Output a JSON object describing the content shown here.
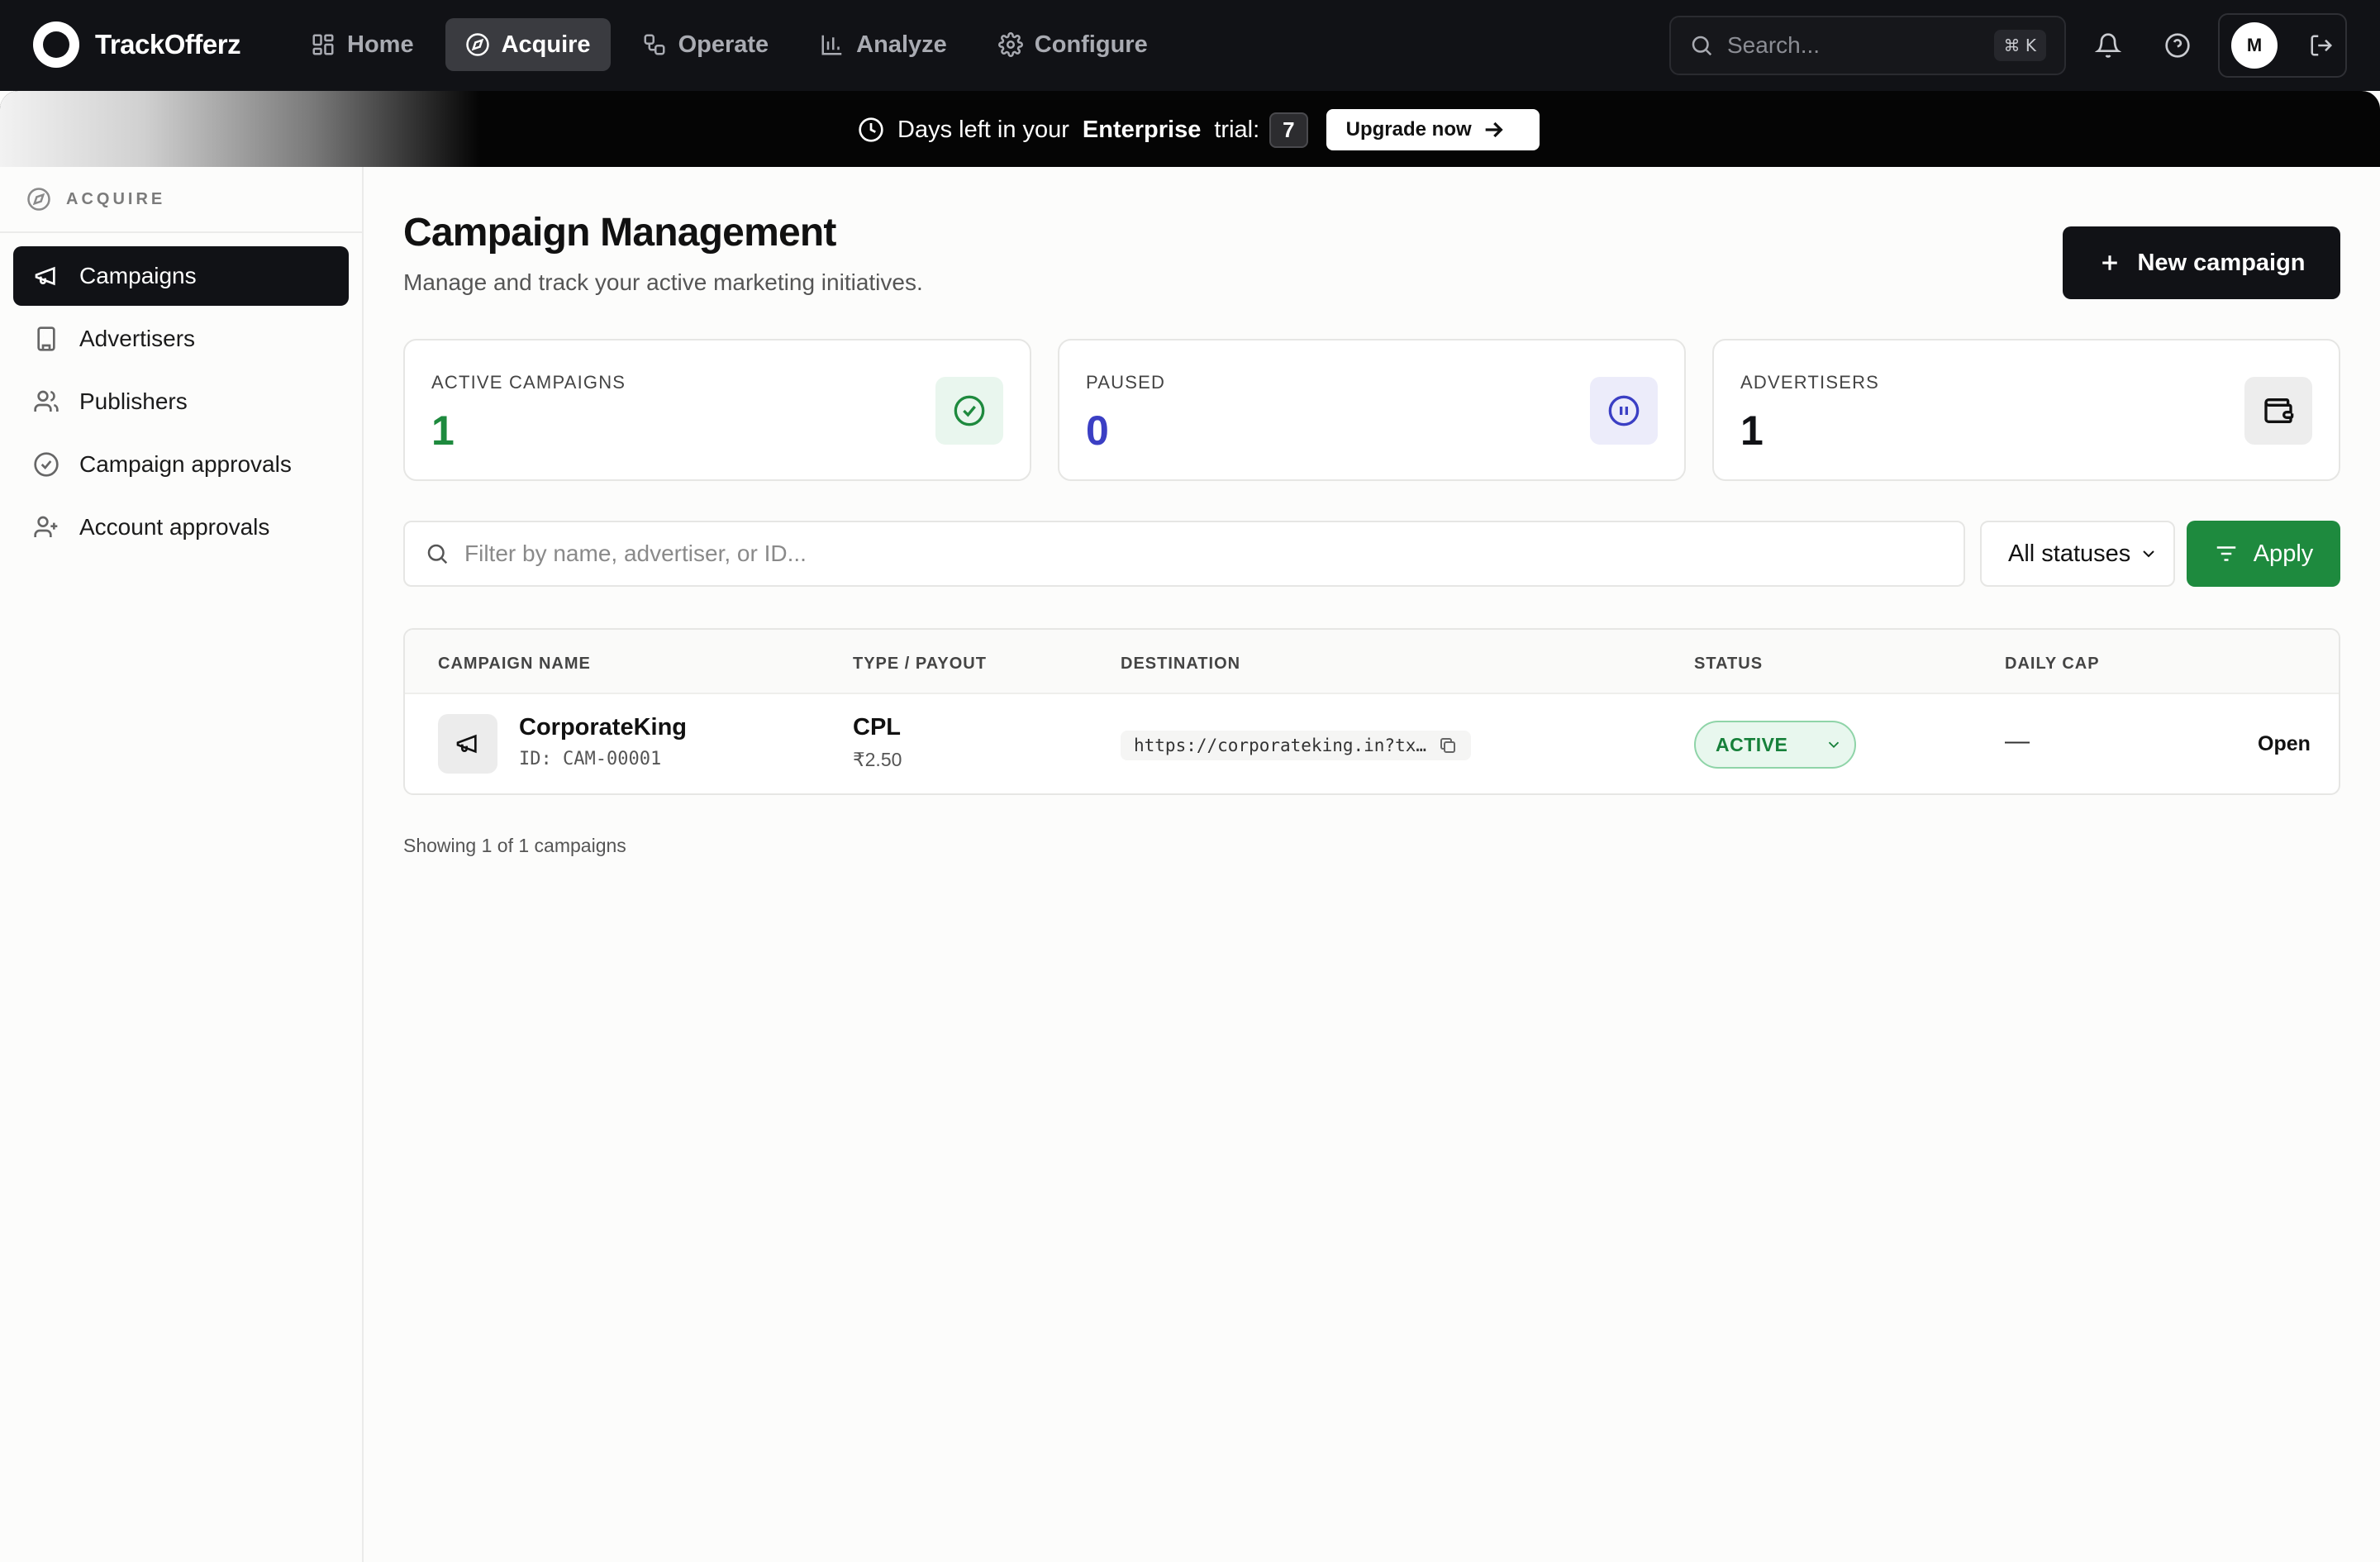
{
  "app": {
    "name": "TrackOfferz"
  },
  "nav": {
    "items": [
      {
        "label": "Home",
        "icon": "layout-grid-icon",
        "active": false
      },
      {
        "label": "Acquire",
        "icon": "compass-icon",
        "active": true
      },
      {
        "label": "Operate",
        "icon": "workflow-icon",
        "active": false
      },
      {
        "label": "Analyze",
        "icon": "bar-chart-icon",
        "active": false
      },
      {
        "label": "Configure",
        "icon": "gear-icon",
        "active": false
      }
    ],
    "search_placeholder": "Search...",
    "search_shortcut": "⌘ K",
    "avatar_initial": "M"
  },
  "banner": {
    "prefix": "Days left in your",
    "plan": "Enterprise",
    "suffix": "trial:",
    "days": "7",
    "upgrade_label": "Upgrade now"
  },
  "sidebar": {
    "section": "ACQUIRE",
    "items": [
      {
        "label": "Campaigns",
        "icon": "megaphone-icon",
        "active": true
      },
      {
        "label": "Advertisers",
        "icon": "building-icon",
        "active": false
      },
      {
        "label": "Publishers",
        "icon": "users-icon",
        "active": false
      },
      {
        "label": "Campaign approvals",
        "icon": "check-circle-icon",
        "active": false
      },
      {
        "label": "Account approvals",
        "icon": "user-plus-icon",
        "active": false
      }
    ]
  },
  "main": {
    "title": "Campaign Management",
    "subtitle": "Manage and track your active marketing initiatives.",
    "new_campaign_label": "New campaign"
  },
  "stats": [
    {
      "label": "ACTIVE CAMPAIGNS",
      "value": "1",
      "color": "#1e8a3e",
      "icon": "check-circle-icon",
      "icon_bg": "#e9f6ee"
    },
    {
      "label": "PAUSED",
      "value": "0",
      "color": "#3b3fc4",
      "icon": "pause-circle-icon",
      "icon_bg": "#ececfa"
    },
    {
      "label": "ADVERTISERS",
      "value": "1",
      "color": "#111216",
      "icon": "wallet-icon",
      "icon_bg": "#ededed"
    }
  ],
  "filter": {
    "placeholder": "Filter by name, advertiser, or ID...",
    "status_selected": "All statuses",
    "apply_label": "Apply"
  },
  "table": {
    "columns": [
      "CAMPAIGN NAME",
      "TYPE / PAYOUT",
      "DESTINATION",
      "STATUS",
      "DAILY CAP"
    ],
    "rows": [
      {
        "name": "CorporateKing",
        "id": "ID: CAM-00001",
        "type": "CPL",
        "payout": "₹2.50",
        "destination": "https://corporateking.in?tx…",
        "status": "ACTIVE",
        "daily_cap": "—",
        "action": "Open"
      }
    ]
  },
  "footer": {
    "showing": "Showing 1 of 1 campaigns"
  }
}
